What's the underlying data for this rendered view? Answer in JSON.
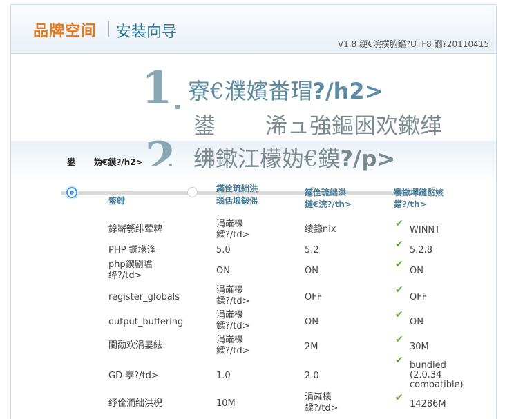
{
  "header": {
    "logo_text": "品牌空间",
    "wizard_title": "安装向导",
    "version": "V1.8 绠€浣撲腑鏂?UTF8 鐗?20110415"
  },
  "steps": {
    "step1_number": "1",
    "step1_title": "寮€濮嬪畨瑁",
    "step1_title_suffix": "?/h2>",
    "step1_subtitle_left": "鍙",
    "step1_subtitle_right": "浠ュ強鏂囦欢鏉缂",
    "step2_number": "2",
    "step2_title": "绋鏉江檬妫€鏌",
    "step2_title_suffix": "?/p>"
  },
  "section": {
    "label_left": "鍙",
    "label_right": "妫€鏌?/h2>"
  },
  "table": {
    "header_col1": "鐜鲱",
    "header_col2_line1": "鏋佺琉絀洪",
    "header_col2_line2": "瑙佸埌鍛傜",
    "header_col3_line1": "鏋佺琉絀洪",
    "header_col3_line2": "鏈€浣?/th>",
    "header_col4_line1": "褰撳墠鏈嶅姟",
    "header_col4_line2": "鍣?/th>",
    "rows": [
      {
        "name": "鎿嶄綔绯荤粺",
        "min": "涓嶉檺\n鍒?/td>",
        "rec": "绫籙nix",
        "current": "WINNT"
      },
      {
        "name": "PHP 鐗堟湰",
        "min": "5.0",
        "rec": "5.2",
        "current": "5.2.8"
      },
      {
        "name": "php鍥剧墖\n绛?/td>",
        "min": "ON",
        "rec": "ON",
        "current": "ON"
      },
      {
        "name": "register_globals",
        "min": "涓嶉檺\n鍒?/td>",
        "rec": "OFF",
        "current": "OFF"
      },
      {
        "name": "output_buffering",
        "min": "涓嶉檺\n鍒?/td>",
        "rec": "ON",
        "current": "ON"
      },
      {
        "name": "闄勪欢涓婁紶",
        "min": "涓嶉檺\n鍒?/td>",
        "rec": "2M",
        "current": "30M"
      },
      {
        "name": "GD 搴?/td>",
        "min": "1.0",
        "rec": "2.0",
        "current": "bundled\n(2.0.34\ncompatible)"
      },
      {
        "name": "纾佺洏绌洪棿",
        "min": "10M",
        "rec": "涓嶉檺\n鍒?/td>",
        "current": "14286M"
      }
    ]
  },
  "progress": {
    "active_step": 1,
    "total_steps": 5
  },
  "colors": {
    "accent": "#2f7a9c",
    "logo": "#e8781c",
    "check": "#5cae2e"
  }
}
